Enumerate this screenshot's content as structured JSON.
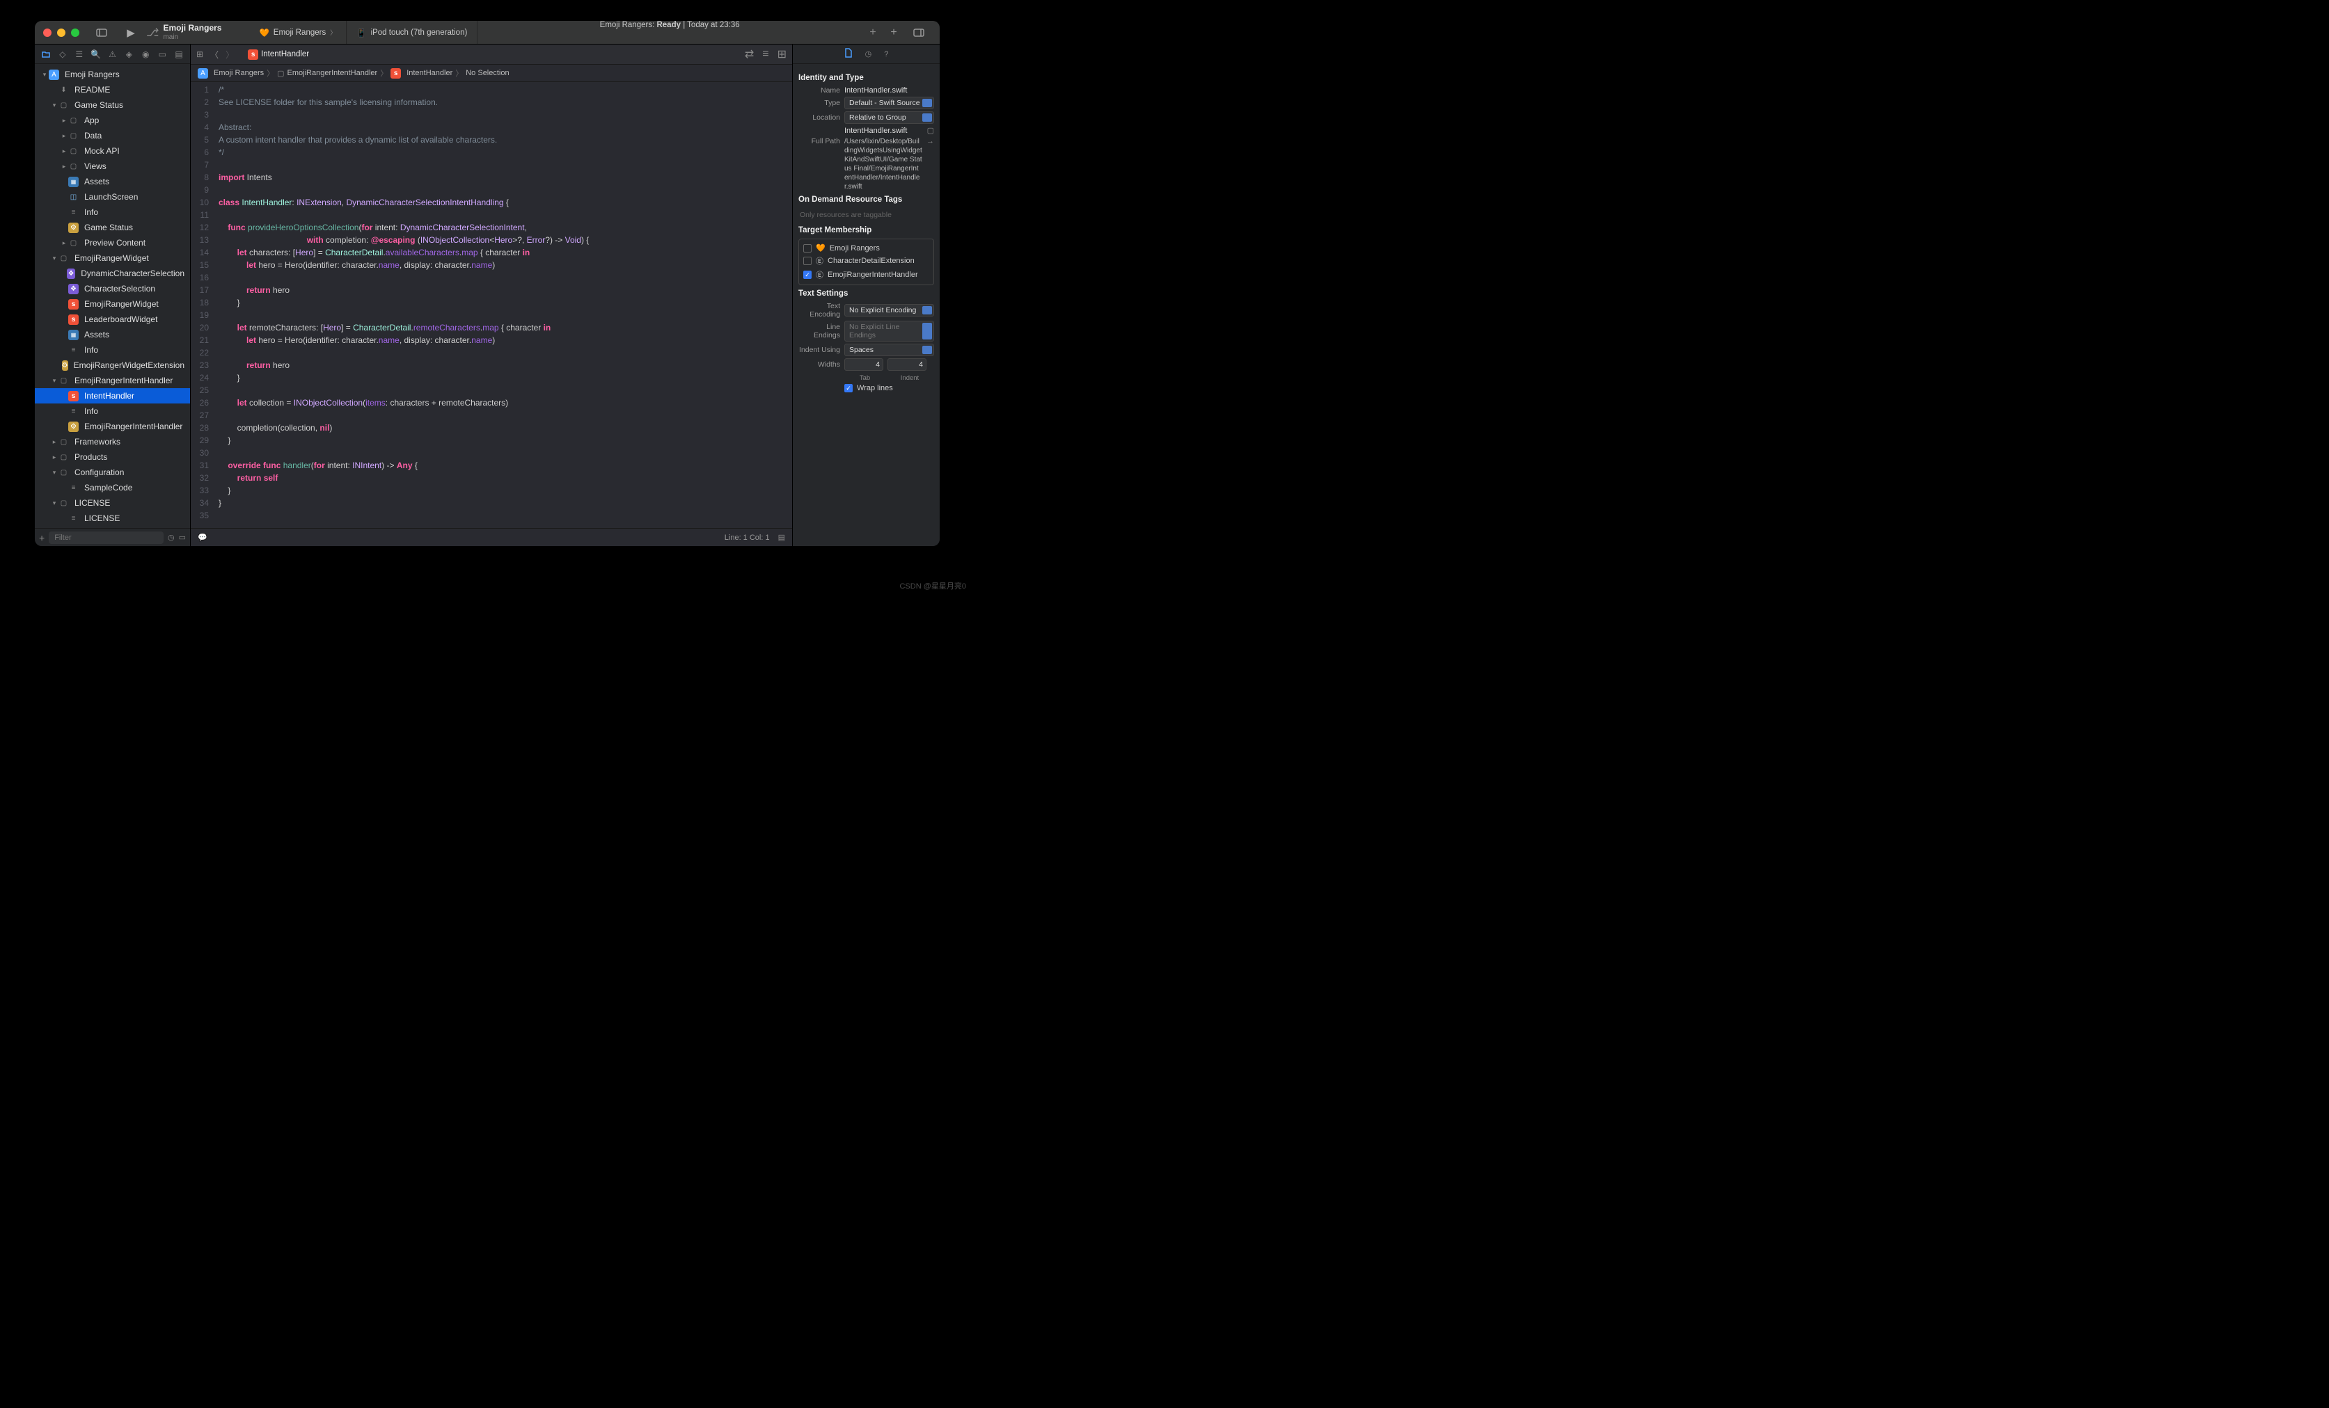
{
  "toolbar": {
    "scheme_name": "Emoji Rangers",
    "branch": "main",
    "tab_scheme": "Emoji Rangers",
    "tab_device": "iPod touch (7th generation)",
    "status_prefix": "Emoji Rangers: ",
    "status_state": "Ready",
    "status_time": " | Today at 23:36"
  },
  "navigator": {
    "filter_placeholder": "Filter",
    "tree": [
      {
        "label": "Emoji Rangers",
        "depth": 0,
        "icon": "proj",
        "disclosure": "▾"
      },
      {
        "label": "README",
        "depth": 1,
        "icon": "md"
      },
      {
        "label": "Game Status",
        "depth": 1,
        "icon": "folder",
        "disclosure": "▾"
      },
      {
        "label": "App",
        "depth": 2,
        "icon": "folder",
        "disclosure": "▸"
      },
      {
        "label": "Data",
        "depth": 2,
        "icon": "folder",
        "disclosure": "▸"
      },
      {
        "label": "Mock API",
        "depth": 2,
        "icon": "folder",
        "disclosure": "▸"
      },
      {
        "label": "Views",
        "depth": 2,
        "icon": "folder",
        "disclosure": "▸"
      },
      {
        "label": "Assets",
        "depth": 2,
        "icon": "asset"
      },
      {
        "label": "LaunchScreen",
        "depth": 2,
        "icon": "stor"
      },
      {
        "label": "Info",
        "depth": 2,
        "icon": "plist"
      },
      {
        "label": "Game Status",
        "depth": 2,
        "icon": "yellow"
      },
      {
        "label": "Preview Content",
        "depth": 2,
        "icon": "folder",
        "disclosure": "▸"
      },
      {
        "label": "EmojiRangerWidget",
        "depth": 1,
        "icon": "folder",
        "disclosure": "▾"
      },
      {
        "label": "DynamicCharacterSelection",
        "depth": 2,
        "icon": "ext"
      },
      {
        "label": "CharacterSelection",
        "depth": 2,
        "icon": "ext"
      },
      {
        "label": "EmojiRangerWidget",
        "depth": 2,
        "icon": "swift"
      },
      {
        "label": "LeaderboardWidget",
        "depth": 2,
        "icon": "swift"
      },
      {
        "label": "Assets",
        "depth": 2,
        "icon": "asset"
      },
      {
        "label": "Info",
        "depth": 2,
        "icon": "plist"
      },
      {
        "label": "EmojiRangerWidgetExtension",
        "depth": 2,
        "icon": "yellow"
      },
      {
        "label": "EmojiRangerIntentHandler",
        "depth": 1,
        "icon": "folder",
        "disclosure": "▾"
      },
      {
        "label": "IntentHandler",
        "depth": 2,
        "icon": "swift",
        "selected": true
      },
      {
        "label": "Info",
        "depth": 2,
        "icon": "plist"
      },
      {
        "label": "EmojiRangerIntentHandler",
        "depth": 2,
        "icon": "yellow"
      },
      {
        "label": "Frameworks",
        "depth": 1,
        "icon": "folder",
        "disclosure": "▸"
      },
      {
        "label": "Products",
        "depth": 1,
        "icon": "folder",
        "disclosure": "▸"
      },
      {
        "label": "Configuration",
        "depth": 1,
        "icon": "folder",
        "disclosure": "▾"
      },
      {
        "label": "SampleCode",
        "depth": 2,
        "icon": "plist"
      },
      {
        "label": "LICENSE",
        "depth": 1,
        "icon": "folder",
        "disclosure": "▾"
      },
      {
        "label": "LICENSE",
        "depth": 2,
        "icon": "plist"
      }
    ]
  },
  "editor": {
    "tab_label": "IntentHandler",
    "jump": [
      "Emoji Rangers",
      "EmojiRangerIntentHandler",
      "IntentHandler",
      "No Selection"
    ],
    "footer_line": "Line: 1  Col: 1",
    "code_lines": 35
  },
  "inspector": {
    "sect_identity": "Identity and Type",
    "name_lbl": "Name",
    "name_val": "IntentHandler.swift",
    "type_lbl": "Type",
    "type_val": "Default - Swift Source",
    "loc_lbl": "Location",
    "loc_val": "Relative to Group",
    "loc_file": "IntentHandler.swift",
    "path_lbl": "Full Path",
    "path_val": "/Users/lixin/Desktop/BuildingWidgetsUsingWidgetKitAndSwiftUI/Game Status Final/EmojiRangerIntentHandler/IntentHandler.swift",
    "sect_odr": "On Demand Resource Tags",
    "odr_ph": "Only resources are taggable",
    "sect_tm": "Target Membership",
    "tm_items": [
      {
        "label": "Emoji Rangers",
        "checked": false,
        "icon": "🧡"
      },
      {
        "label": "CharacterDetailExtension",
        "checked": false,
        "icon": "Ⓔ"
      },
      {
        "label": "EmojiRangerIntentHandler",
        "checked": true,
        "icon": "Ⓔ"
      }
    ],
    "sect_text": "Text Settings",
    "enc_lbl": "Text Encoding",
    "enc_val": "No Explicit Encoding",
    "le_lbl": "Line Endings",
    "le_val": "No Explicit Line Endings",
    "indent_lbl": "Indent Using",
    "indent_val": "Spaces",
    "widths_lbl": "Widths",
    "tab_val": "4",
    "indent_val2": "4",
    "tab_sub": "Tab",
    "indent_sub": "Indent",
    "wrap_lbl": "Wrap lines"
  },
  "watermark": "CSDN @星星月亮0"
}
